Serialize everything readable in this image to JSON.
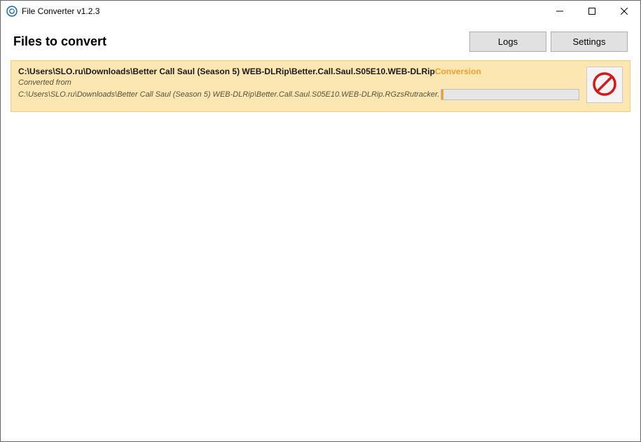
{
  "window": {
    "title": "File Converter v1.2.3"
  },
  "header": {
    "title": "Files to convert",
    "logs_label": "Logs",
    "settings_label": "Settings"
  },
  "item": {
    "output_path": "C:\\Users\\SLO.ru\\Downloads\\Better Call Saul (Season 5) WEB-DLRip\\Better.Call.Saul.S05E10.WEB-DLRip",
    "status": "Conversion",
    "converted_from_label": "Converted from",
    "source_path": "C:\\Users\\SLO.ru\\Downloads\\Better Call Saul (Season 5) WEB-DLRip\\Better.Call.Saul.S05E10.WEB-DLRip.RGzsRutracker."
  }
}
